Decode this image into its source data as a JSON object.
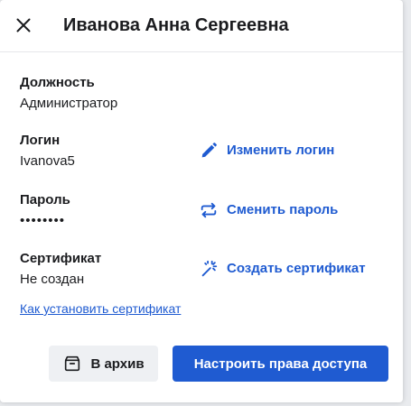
{
  "dialog": {
    "title": "Иванова Анна Сергеевна"
  },
  "fields": {
    "position": {
      "label": "Должность",
      "value": "Администратор"
    },
    "login": {
      "label": "Логин",
      "value": "Ivanova5",
      "action_label": "Изменить логин",
      "action_icon": "pencil-icon"
    },
    "password": {
      "label": "Пароль",
      "value": "••••••••",
      "action_label": "Сменить пароль",
      "action_icon": "swap-arrows-icon"
    },
    "certificate": {
      "label": "Сертификат",
      "value": "Не создан",
      "action_label": "Создать сертификат",
      "action_icon": "magic-wand-icon"
    }
  },
  "help_link": "Как установить сертификат",
  "buttons": {
    "archive": {
      "label": "В архив",
      "icon": "archive-box-icon"
    },
    "access": {
      "label": "Настроить права доступа"
    }
  },
  "colors": {
    "accent": "#1f5bd1",
    "text": "#1b1c1f",
    "secondary_button_bg": "#eef0f3",
    "backdrop": "#e9ebee"
  }
}
